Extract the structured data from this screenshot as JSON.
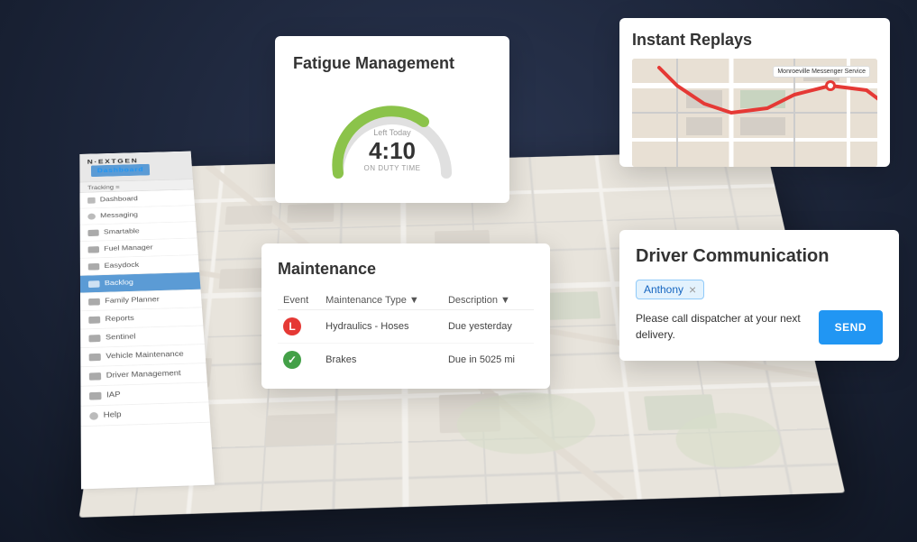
{
  "brand": {
    "logo_text": "N·EXTGEN",
    "logo_highlight": "N·EXT",
    "logo_rest": "GEN"
  },
  "nav": {
    "dashboard_label": "Dashboard",
    "tracking_label": "Tracking ≡"
  },
  "sidebar": {
    "items": [
      {
        "label": "Dashboard",
        "active": false
      },
      {
        "label": "Messaging",
        "active": false
      },
      {
        "label": "Smartable",
        "active": false
      },
      {
        "label": "Fuel Manager",
        "active": false
      },
      {
        "label": "Easydock",
        "active": false
      },
      {
        "label": "Backlog",
        "active": true
      },
      {
        "label": "Family Planner",
        "active": false
      },
      {
        "label": "Reports",
        "active": false
      },
      {
        "label": "Sentinel",
        "active": false
      },
      {
        "label": "Vehicle Maintenance",
        "active": false
      },
      {
        "label": "Driver Management",
        "active": false
      },
      {
        "label": "IAP",
        "active": false
      },
      {
        "label": "Help",
        "active": false
      }
    ]
  },
  "fatigue_card": {
    "title": "Fatigue Management",
    "gauge_label": "Left Today",
    "gauge_time": "4:10",
    "gauge_sublabel": "ON DUTY TIME",
    "gauge_value": 75
  },
  "maintenance_card": {
    "title": "Maintenance",
    "columns": [
      "Event",
      "Maintenance Type ▼",
      "Description ▼"
    ],
    "rows": [
      {
        "status": "red",
        "type": "Hydraulics - Hoses",
        "description": "Due yesterday"
      },
      {
        "status": "green",
        "type": "Brakes",
        "description": "Due in 5025 mi"
      }
    ]
  },
  "replay_card": {
    "title": "Instant Replays",
    "map_label": "Monroeville Messenger Service"
  },
  "driver_card": {
    "title": "Driver Communication",
    "recipient": "Anthony",
    "close_icon": "×",
    "message": "Please call dispatcher at your next delivery.",
    "send_label": "SEND"
  }
}
